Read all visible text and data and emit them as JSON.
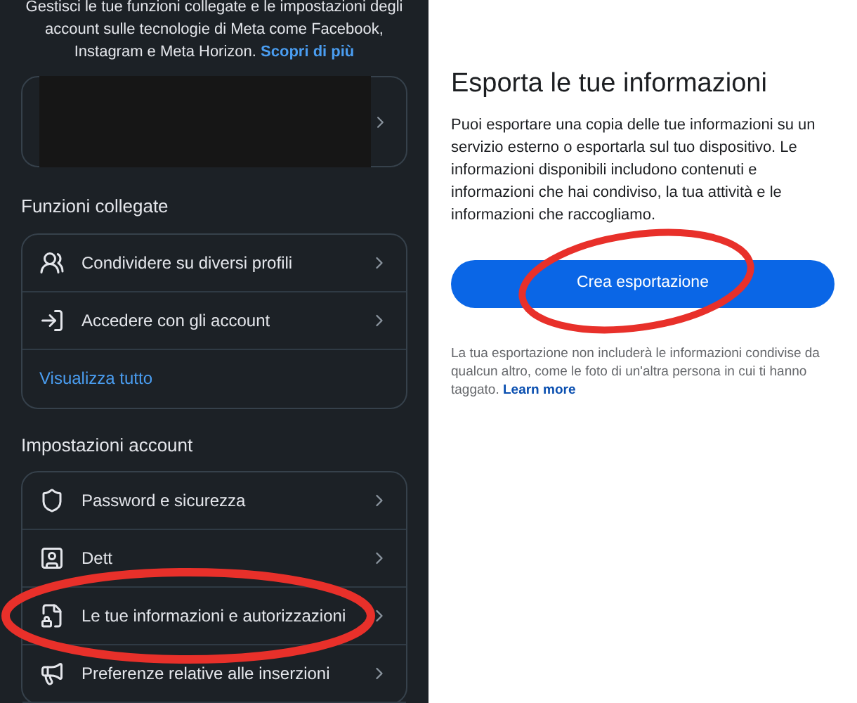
{
  "left_panel": {
    "intro": {
      "text": "Gestisci le tue funzioni collegate e le impostazioni degli account sulle tecnologie di Meta come Facebook, Instagram e Meta Horizon.",
      "link": "Scopri di più"
    },
    "linked_features": {
      "title": "Funzioni collegate",
      "items": [
        {
          "label": "Condividere su diversi profili"
        },
        {
          "label": "Accedere con gli account"
        }
      ],
      "view_all": "Visualizza tutto"
    },
    "account_settings": {
      "title": "Impostazioni account",
      "items": [
        {
          "label": "Password e sicurezza"
        },
        {
          "label": "Dett"
        },
        {
          "label": "Le tue informazioni e autorizzazioni"
        },
        {
          "label": "Preferenze relative alle inserzioni"
        }
      ]
    }
  },
  "right_panel": {
    "title": "Esporta le tue informazioni",
    "description": "Puoi esportare una copia delle tue informazioni su un servizio esterno o esportarla sul tuo dispositivo. Le informazioni disponibili includono contenuti e informazioni che hai condiviso, la tua attività e le informazioni che raccogliamo.",
    "button": "Crea esportazione",
    "note": "La tua esportazione non includerà le informazioni condivise da qualcun altro, come le foto di un'altra persona in cui ti hanno taggato.",
    "note_link": "Learn more"
  }
}
